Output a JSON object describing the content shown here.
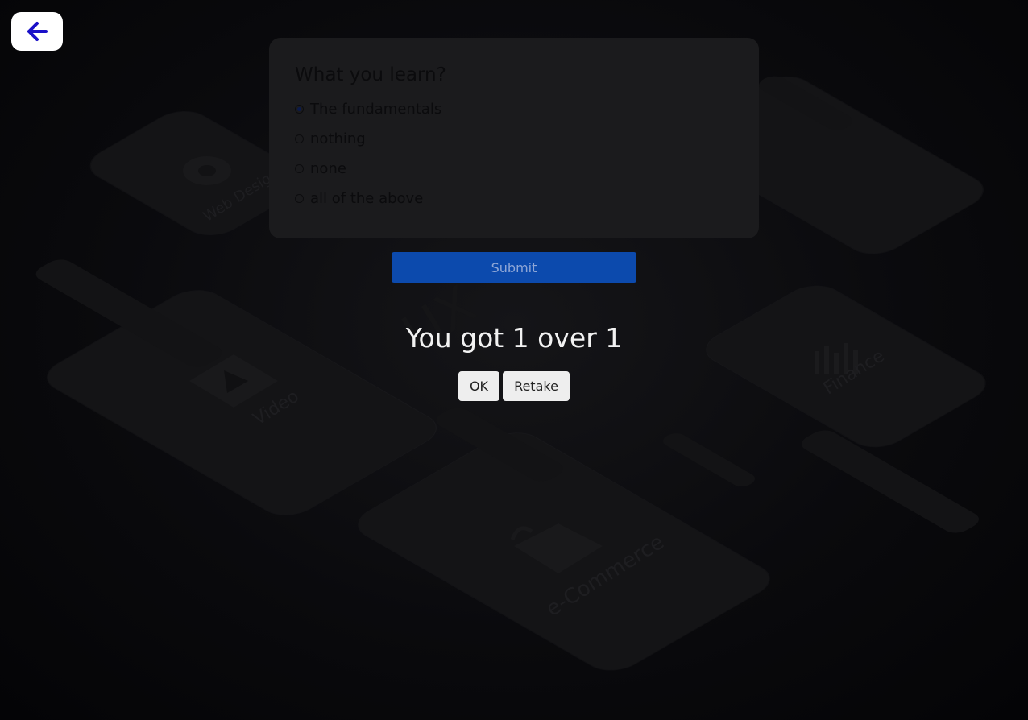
{
  "nav": {
    "back_icon": "arrow-left-icon",
    "back_color": "#1a10c8"
  },
  "quiz": {
    "question": "What you learn?",
    "options": [
      {
        "label": "The fundamentals",
        "checked": true
      },
      {
        "label": "nothing",
        "checked": false
      },
      {
        "label": "none",
        "checked": false
      },
      {
        "label": "all of the above",
        "checked": false
      }
    ],
    "submit_label": "Submit"
  },
  "result": {
    "text": "You got 1 over 1"
  },
  "actions": {
    "ok_label": "OK",
    "retake_label": "Retake"
  },
  "background": {
    "labels": [
      "Web Design",
      "Video",
      "Finance",
      "e-Commerce",
      "UX"
    ]
  },
  "colors": {
    "submit": "#0c4aad",
    "page_bg": "#050507",
    "card_bg": "#1b1b1d"
  }
}
